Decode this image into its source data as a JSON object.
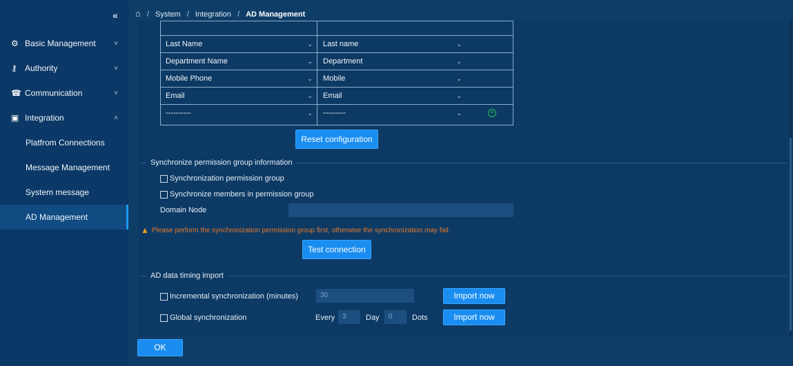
{
  "sidebar": {
    "collapse_icon": "«",
    "items": [
      {
        "label": "Basic Management",
        "icon": "gear-icon",
        "chev": "˅"
      },
      {
        "label": "Authority",
        "icon": "key-icon",
        "chev": "˅"
      },
      {
        "label": "Communication",
        "icon": "phone-icon",
        "chev": "˅"
      },
      {
        "label": "Integration",
        "icon": "grid-icon",
        "chev": "˄"
      }
    ],
    "sub_items": [
      {
        "label": "Platfrom Connections"
      },
      {
        "label": "Message Management"
      },
      {
        "label": "System message"
      },
      {
        "label": "AD Management"
      }
    ]
  },
  "breadcrumb": {
    "home_icon": "home-icon",
    "sep": "/",
    "items": [
      "System",
      "Integration",
      "AD Management"
    ]
  },
  "mapping": {
    "rows": [
      {
        "left": "Last Name",
        "right": "Last name"
      },
      {
        "left": "Department Name",
        "right": "Department"
      },
      {
        "left": "Mobile Phone",
        "right": "Mobile"
      },
      {
        "left": "Email",
        "right": "Email"
      },
      {
        "left": "----------",
        "right": "---------"
      }
    ],
    "dropdown_glyph": "⌄"
  },
  "reset_button": "Reset configuration",
  "permission_section": {
    "title": "Synchronize permission group information",
    "check1": "Synchronization permission group",
    "check2": "Synchronize members in permission group",
    "domain_label": "Domain Node",
    "warning": "Please perform the synchronization permission group first, otherwise the synchronization may fail.",
    "test_button": "Test connection"
  },
  "timing_section": {
    "title": "AD data timing import",
    "incremental_label": "Incremental synchronization (minutes)",
    "incremental_value": "30",
    "global_label": "Global synchronization",
    "every_label": "Every",
    "every_value": "3",
    "day_label": "Day",
    "day_value": "0",
    "dots_label": "Dots",
    "import_button": "Import now"
  },
  "ok_button": "OK",
  "colors": {
    "accent": "#1a8df0",
    "warning": "#e6792e",
    "background": "#0e3d68"
  }
}
